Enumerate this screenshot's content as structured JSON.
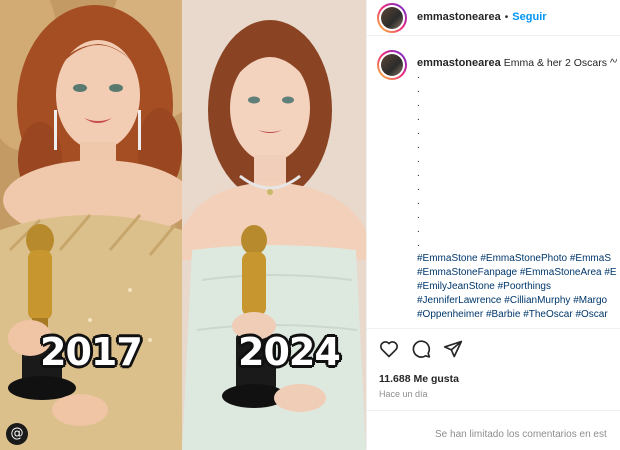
{
  "photos": {
    "left_year": "2017",
    "right_year": "2024"
  },
  "header": {
    "username": "emmastonearea",
    "separator": "•",
    "follow_label": "Seguir"
  },
  "caption": {
    "username": "emmastonearea",
    "text": "Emma & her 2 Oscars ^^",
    "dots": [
      ".",
      ".",
      ".",
      ".",
      ".",
      ".",
      ".",
      ".",
      ".",
      ".",
      ".",
      ".",
      "."
    ],
    "hashtag_lines": [
      [
        "#EmmaStone",
        "#EmmaStonePhoto",
        "#EmmaS"
      ],
      [
        "#EmmaStoneFanpage",
        "#EmmaStoneArea",
        "#Emm"
      ],
      [
        "#EmilyJeanStone",
        "#Poorthings"
      ],
      [
        "#JenniferLawrence",
        "#CillianMurphy",
        "#Margo"
      ],
      [
        "#Oppenheimer",
        "#Barbie",
        "#TheOscar",
        "#Oscar"
      ]
    ]
  },
  "actions": {
    "icons": [
      "heart-icon",
      "comment-icon",
      "share-icon"
    ],
    "likes": "11.688 Me gusta",
    "time": "Hace un día"
  },
  "comments": {
    "limited_text": "Se han limitado los comentarios en est"
  }
}
